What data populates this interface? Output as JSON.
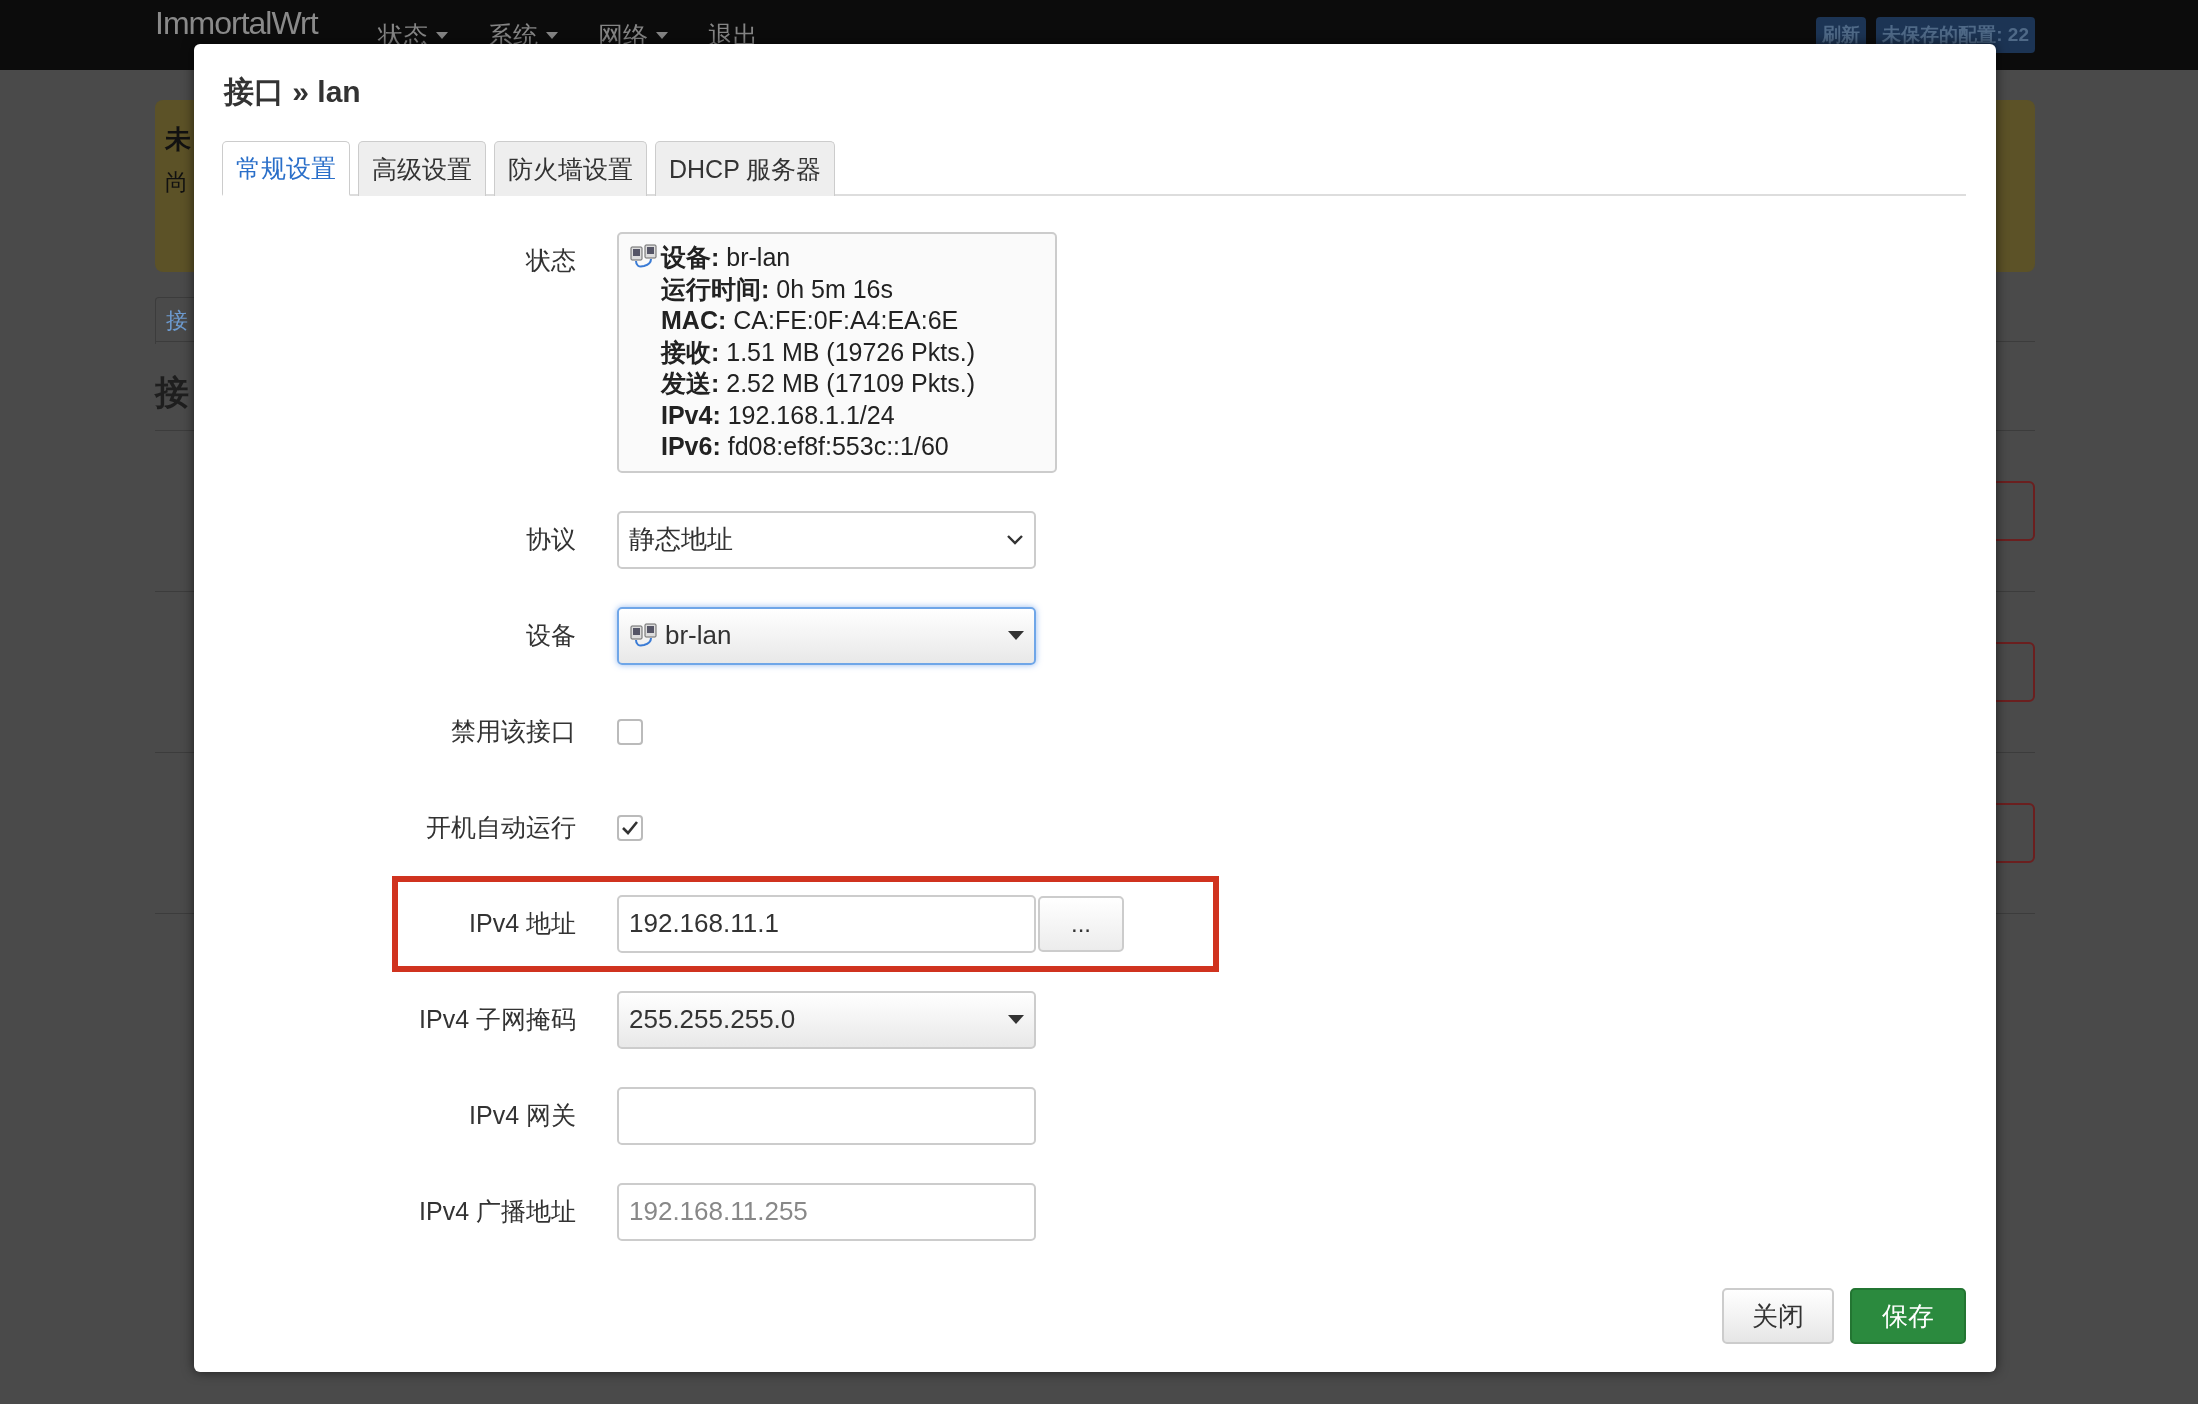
{
  "navbar": {
    "brand": "ImmortalWrt",
    "menu": [
      {
        "label": "状态",
        "dropdown": true
      },
      {
        "label": "系统",
        "dropdown": true
      },
      {
        "label": "网络",
        "dropdown": true
      },
      {
        "label": "退出",
        "dropdown": false
      }
    ],
    "badges": [
      "刷新",
      "未保存的配置: 22"
    ]
  },
  "background": {
    "alert_title": "未",
    "alert_text": "尚",
    "tab": "接",
    "heading": "接"
  },
  "modal": {
    "title": "接口 » lan",
    "tabs": [
      {
        "label": "常规设置",
        "selected": true
      },
      {
        "label": "高级设置",
        "selected": false
      },
      {
        "label": "防火墙设置",
        "selected": false
      },
      {
        "label": "DHCP 服务器",
        "selected": false
      }
    ],
    "status": {
      "label": "状态",
      "lines": [
        "**设备:** br-lan",
        "**运行时间:** 0h 5m 16s",
        "**MAC:** CA:FE:0F:A4:EA:6E",
        "**接收:** 1.51 MB (19726 Pkts.)",
        "**发送:** 2.52 MB (17109 Pkts.)",
        "**IPv4:** 192.168.1.1/24",
        "**IPv6:** fd08:ef8f:553c::1/60"
      ]
    },
    "fields": [
      {
        "kind": "select",
        "label": "协议",
        "value": "静态地址"
      },
      {
        "kind": "device",
        "label": "设备",
        "value": "br-lan",
        "focused": true
      },
      {
        "kind": "checkbox",
        "label": "禁用该接口",
        "checked": false
      },
      {
        "kind": "checkbox",
        "label": "开机自动运行",
        "checked": true
      },
      {
        "kind": "text",
        "label": "IPv4 地址",
        "value": "192.168.11.1",
        "button": "...",
        "highlighted": true
      },
      {
        "kind": "combo",
        "label": "IPv4 子网掩码",
        "value": "255.255.255.0"
      },
      {
        "kind": "text",
        "label": "IPv4 网关",
        "highlighted": false
      },
      {
        "kind": "text",
        "label": "IPv4 广播地址",
        "placeholder": "192.168.11.255",
        "highlighted": false
      }
    ],
    "buttons": [
      {
        "label": "关闭",
        "kind": "default"
      },
      {
        "label": "保存",
        "kind": "primary"
      }
    ]
  }
}
